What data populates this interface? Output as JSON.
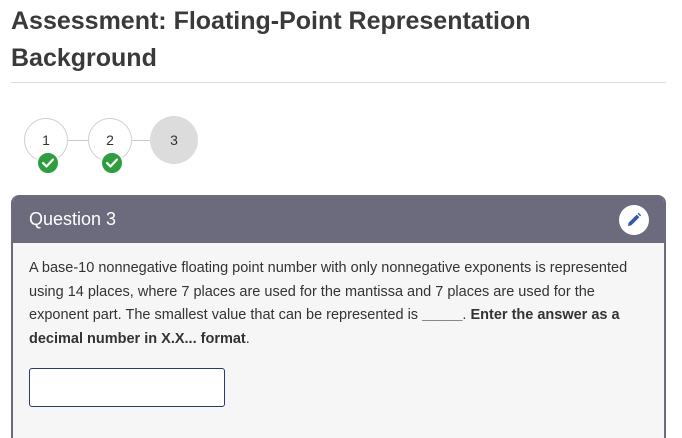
{
  "page": {
    "title": "Assessment: Floating-Point Representation Background"
  },
  "stepper": {
    "steps": [
      {
        "label": "1",
        "completed": true
      },
      {
        "label": "2",
        "completed": true
      },
      {
        "label": "3",
        "completed": false,
        "current": true
      }
    ]
  },
  "question": {
    "title": "Question 3",
    "text_part1": "A base-10 nonnegative floating point number with only nonnegative exponents is represented using ",
    "places_total": "14",
    "text_part2": " places, where 7 places are used for the mantissa and 7 places are used for the exponent part. The smallest value that can be represented is ",
    "blank": "_____",
    "text_part3": ". ",
    "instruction": "Enter the answer as a decimal number in X.X... format",
    "instruction_end": ".",
    "answer_value": "",
    "answer_placeholder": ""
  },
  "colors": {
    "header_bg": "#6b6b7d",
    "check_green": "#2e9e3e",
    "input_border": "#2b3b6b",
    "edit_icon": "#2f5aa8"
  },
  "icons": {
    "step_check": "check-icon",
    "edit": "pencil-icon"
  }
}
